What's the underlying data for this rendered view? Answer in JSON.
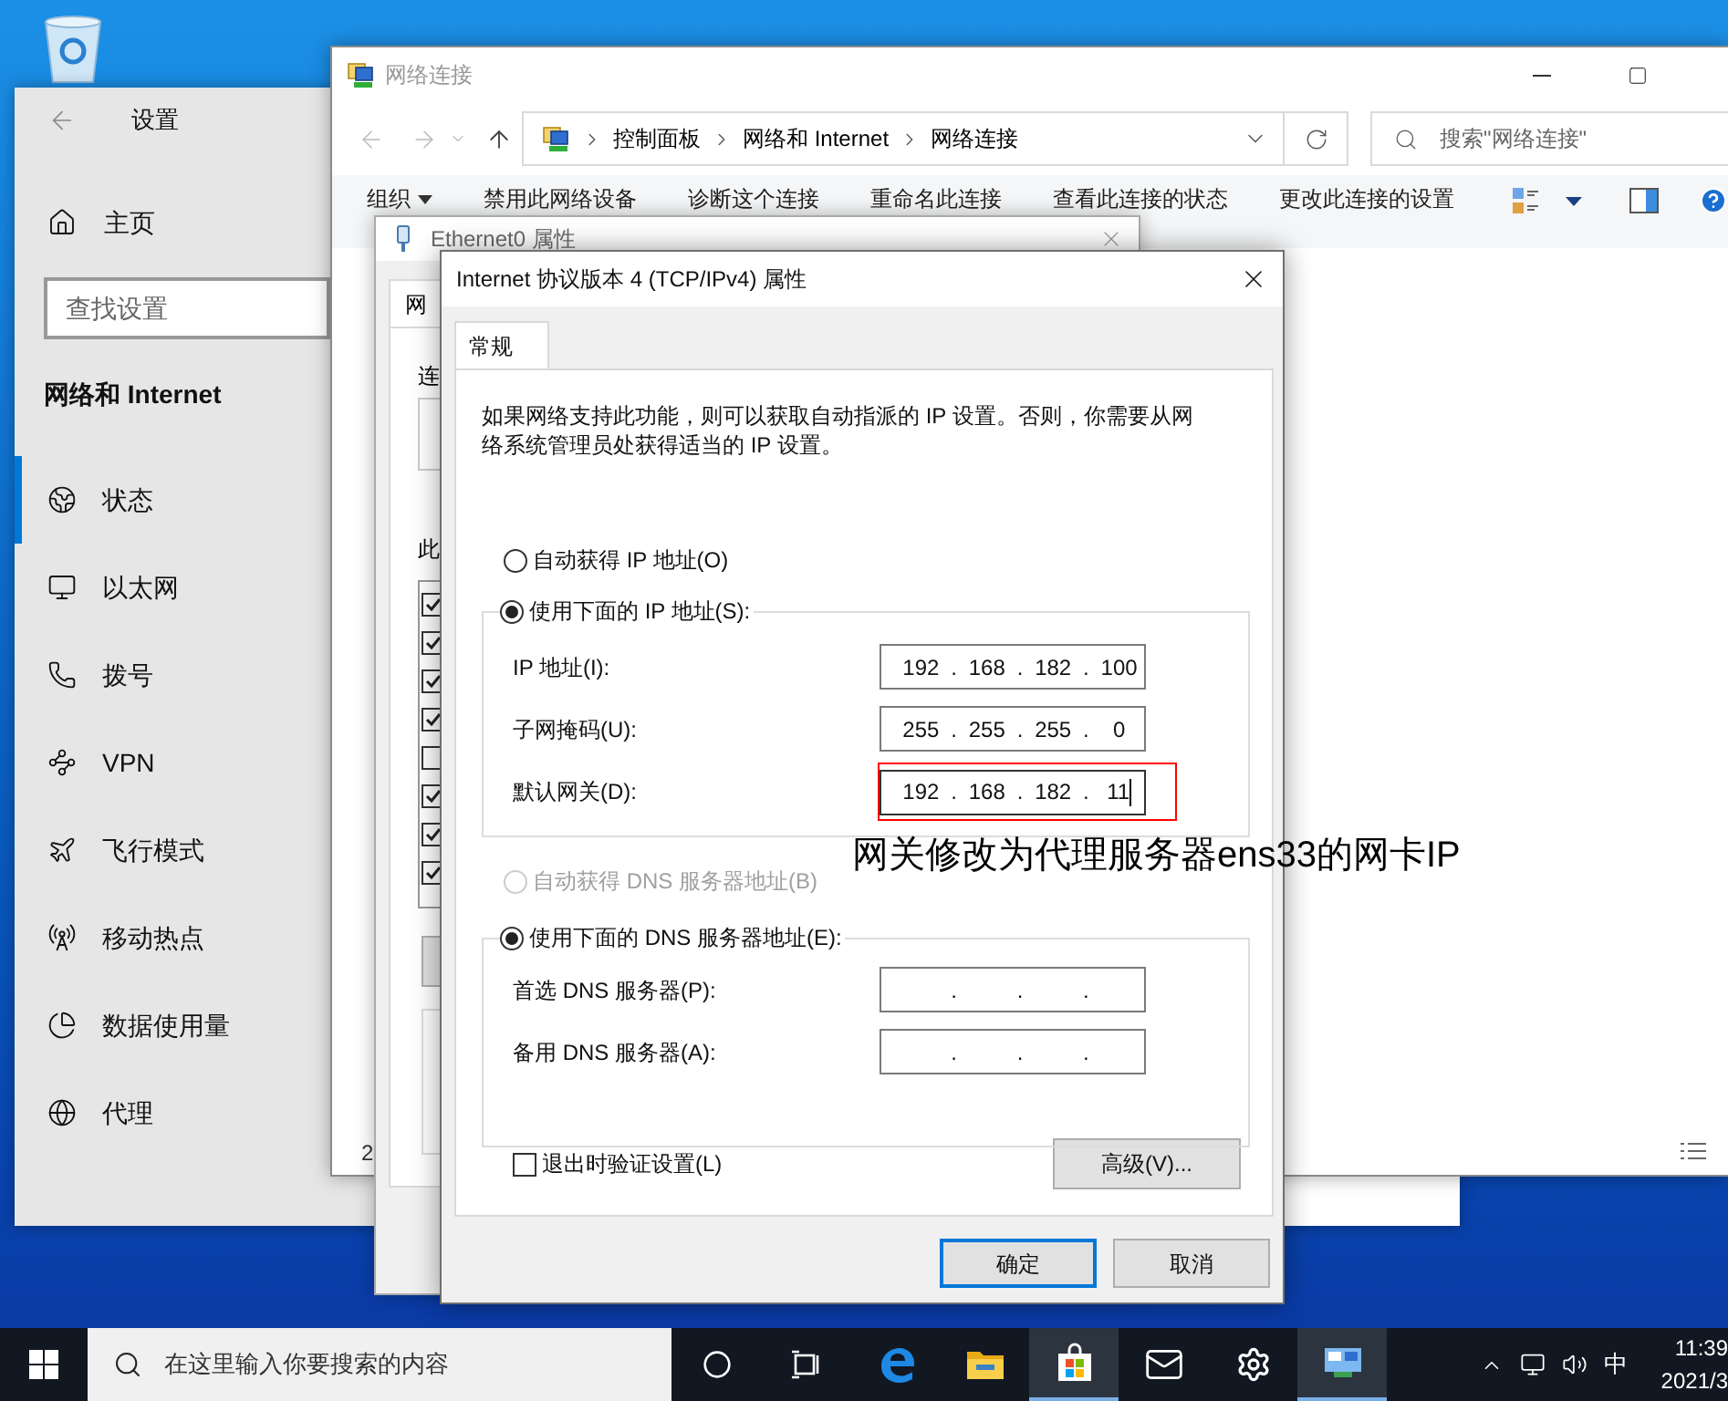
{
  "settings": {
    "title": "设置",
    "home": "主页",
    "search": {
      "placeholder": "查找设置"
    },
    "section": "网络和 Internet",
    "items": [
      {
        "kind": "status",
        "label": "状态",
        "selected": true
      },
      {
        "kind": "ethernet",
        "label": "以太网",
        "selected": false
      },
      {
        "kind": "dialup",
        "label": "拨号",
        "selected": false
      },
      {
        "kind": "vpn",
        "label": "VPN",
        "selected": false
      },
      {
        "kind": "airplane",
        "label": "飞行模式",
        "selected": false
      },
      {
        "kind": "hotspot",
        "label": "移动热点",
        "selected": false
      },
      {
        "kind": "data",
        "label": "数据使用量",
        "selected": false
      },
      {
        "kind": "proxy",
        "label": "代理",
        "selected": false
      }
    ]
  },
  "explorer": {
    "title": "网络连接",
    "breadcrumb": [
      "控制面板",
      "网络和 Internet",
      "网络连接"
    ],
    "search": {
      "placeholder": "搜索\"网络连接\""
    },
    "toolbar": [
      {
        "label": "组织",
        "menu": true
      },
      {
        "label": "禁用此网络设备",
        "menu": false
      },
      {
        "label": "诊断这个连接",
        "menu": false
      },
      {
        "label": "重命名此连接",
        "menu": false
      },
      {
        "label": "查看此连接的状态",
        "menu": false
      },
      {
        "label": "更改此连接的设置",
        "menu": false
      }
    ],
    "status": "2"
  },
  "ethernet_properties": {
    "title": "Ethernet0 属性",
    "tab": "网",
    "labels": [
      "连",
      "此"
    ],
    "components": [
      {
        "checked": true
      },
      {
        "checked": true
      },
      {
        "checked": true
      },
      {
        "checked": true
      },
      {
        "checked": false
      },
      {
        "checked": true
      },
      {
        "checked": true
      },
      {
        "checked": true
      }
    ]
  },
  "ipv4_dialog": {
    "title": "Internet 协议版本 4 (TCP/IPv4) 属性",
    "tabs": [
      {
        "label": "常规",
        "selected": true
      }
    ],
    "description": "如果网络支持此功能，则可以获取自动指派的 IP 设置。否则，你需要从网络系统管理员处获得适当的 IP 设置。",
    "separator": ".",
    "ip_options": [
      {
        "label": "自动获得 IP 地址(O)",
        "selected": false,
        "disabled": false
      },
      {
        "label": "使用下面的 IP 地址(S):",
        "selected": true,
        "disabled": false
      }
    ],
    "ip_fields": [
      {
        "label": "IP 地址(I):",
        "octets": [
          "192",
          "168",
          "182",
          "100"
        ],
        "focused": false,
        "highlighted": false
      },
      {
        "label": "子网掩码(U):",
        "octets": [
          "255",
          "255",
          "255",
          "0"
        ],
        "focused": false,
        "highlighted": false
      },
      {
        "label": "默认网关(D):",
        "octets": [
          "192",
          "168",
          "182",
          "11"
        ],
        "focused": true,
        "highlighted": true
      }
    ],
    "dns_options": [
      {
        "label": "自动获得 DNS 服务器地址(B)",
        "selected": false,
        "disabled": true
      },
      {
        "label": "使用下面的 DNS 服务器地址(E):",
        "selected": true,
        "disabled": false
      }
    ],
    "dns_fields": [
      {
        "label": "首选 DNS 服务器(P):",
        "focused": false,
        "highlighted": false
      },
      {
        "label": "备用 DNS 服务器(A):",
        "focused": false,
        "highlighted": false
      }
    ],
    "validate": {
      "label": "退出时验证设置(L)",
      "checked": false
    },
    "advanced": "高级(V)...",
    "buttons": [
      {
        "label": "确定",
        "default": true
      },
      {
        "label": "取消",
        "default": false
      }
    ]
  },
  "annotation": "网关修改为代理服务器ens33的网卡IP",
  "taskbar": {
    "search": {
      "placeholder": "在这里输入你要搜索的内容"
    },
    "apps": [
      {
        "kind": "cortana",
        "active": false
      },
      {
        "kind": "taskview",
        "active": false
      },
      {
        "kind": "edge",
        "active": false
      },
      {
        "kind": "explorer",
        "active": false
      },
      {
        "kind": "store",
        "active": true
      },
      {
        "kind": "mail",
        "active": false
      },
      {
        "kind": "settings",
        "active": false
      },
      {
        "kind": "network",
        "active": true
      }
    ],
    "ime": "中",
    "time": "11:39",
    "date": "2021/3"
  }
}
